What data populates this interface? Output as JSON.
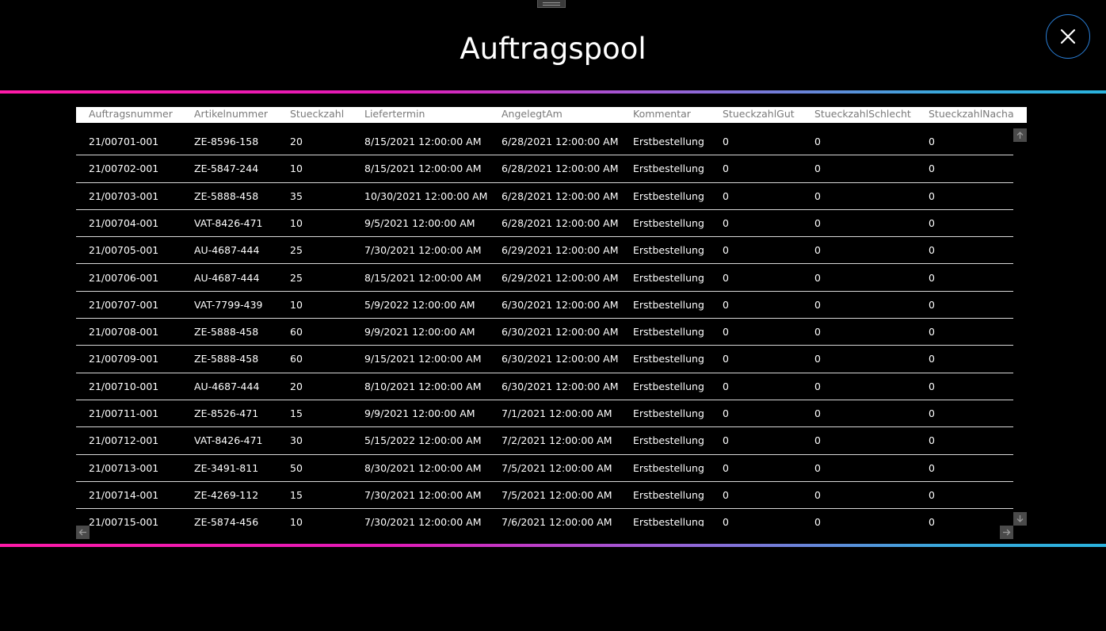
{
  "window": {
    "title": "Auftragspool"
  },
  "icons": {
    "close": "close-icon",
    "scroll_up": "arrow-up-icon",
    "scroll_down": "arrow-down-icon",
    "scroll_left": "arrow-left-icon",
    "scroll_right": "arrow-right-icon",
    "drag_handle": "drag-handle-icon"
  },
  "colors": {
    "background": "#000000",
    "accent_pink": "#ff1aa8",
    "accent_blue": "#2ab3de",
    "close_ring": "#2a7fd8",
    "header_bg": "#ffffff",
    "header_text": "#7a7a7a"
  },
  "grid": {
    "columns": [
      "Auftragsnummer",
      "Artikelnummer",
      "Stueckzahl",
      "Liefertermin",
      "AngelegtAm",
      "Kommentar",
      "StueckzahlGut",
      "StueckzahlSchlecht",
      "StueckzahlNacharl"
    ],
    "rows": [
      [
        "21/00701-001",
        "ZE-8596-158",
        "20",
        "8/15/2021 12:00:00 AM",
        "6/28/2021 12:00:00 AM",
        "Erstbestellung",
        "0",
        "0",
        "0"
      ],
      [
        "21/00702-001",
        "ZE-5847-244",
        "10",
        "8/15/2021 12:00:00 AM",
        "6/28/2021 12:00:00 AM",
        "Erstbestellung",
        "0",
        "0",
        "0"
      ],
      [
        "21/00703-001",
        "ZE-5888-458",
        "35",
        "10/30/2021 12:00:00 AM",
        "6/28/2021 12:00:00 AM",
        "Erstbestellung",
        "0",
        "0",
        "0"
      ],
      [
        "21/00704-001",
        "VAT-8426-471",
        "10",
        "9/5/2021 12:00:00 AM",
        "6/28/2021 12:00:00 AM",
        "Erstbestellung",
        "0",
        "0",
        "0"
      ],
      [
        "21/00705-001",
        "AU-4687-444",
        "25",
        "7/30/2021 12:00:00 AM",
        "6/29/2021 12:00:00 AM",
        "Erstbestellung",
        "0",
        "0",
        "0"
      ],
      [
        "21/00706-001",
        "AU-4687-444",
        "25",
        "8/15/2021 12:00:00 AM",
        "6/29/2021 12:00:00 AM",
        "Erstbestellung",
        "0",
        "0",
        "0"
      ],
      [
        "21/00707-001",
        "VAT-7799-439",
        "10",
        "5/9/2022 12:00:00 AM",
        "6/30/2021 12:00:00 AM",
        "Erstbestellung",
        "0",
        "0",
        "0"
      ],
      [
        "21/00708-001",
        "ZE-5888-458",
        "60",
        "9/9/2021 12:00:00 AM",
        "6/30/2021 12:00:00 AM",
        "Erstbestellung",
        "0",
        "0",
        "0"
      ],
      [
        "21/00709-001",
        "ZE-5888-458",
        "60",
        "9/15/2021 12:00:00 AM",
        "6/30/2021 12:00:00 AM",
        "Erstbestellung",
        "0",
        "0",
        "0"
      ],
      [
        "21/00710-001",
        "AU-4687-444",
        "20",
        "8/10/2021 12:00:00 AM",
        "6/30/2021 12:00:00 AM",
        "Erstbestellung",
        "0",
        "0",
        "0"
      ],
      [
        "21/00711-001",
        "ZE-8526-471",
        "15",
        "9/9/2021 12:00:00 AM",
        "7/1/2021 12:00:00 AM",
        "Erstbestellung",
        "0",
        "0",
        "0"
      ],
      [
        "21/00712-001",
        "VAT-8426-471",
        "30",
        "5/15/2022 12:00:00 AM",
        "7/2/2021 12:00:00 AM",
        "Erstbestellung",
        "0",
        "0",
        "0"
      ],
      [
        "21/00713-001",
        "ZE-3491-811",
        "50",
        "8/30/2021 12:00:00 AM",
        "7/5/2021 12:00:00 AM",
        "Erstbestellung",
        "0",
        "0",
        "0"
      ],
      [
        "21/00714-001",
        "ZE-4269-112",
        "15",
        "7/30/2021 12:00:00 AM",
        "7/5/2021 12:00:00 AM",
        "Erstbestellung",
        "0",
        "0",
        "0"
      ],
      [
        "21/00715-001",
        "ZE-5874-456",
        "10",
        "7/30/2021 12:00:00 AM",
        "7/6/2021 12:00:00 AM",
        "Erstbestellung",
        "0",
        "0",
        "0"
      ]
    ]
  }
}
